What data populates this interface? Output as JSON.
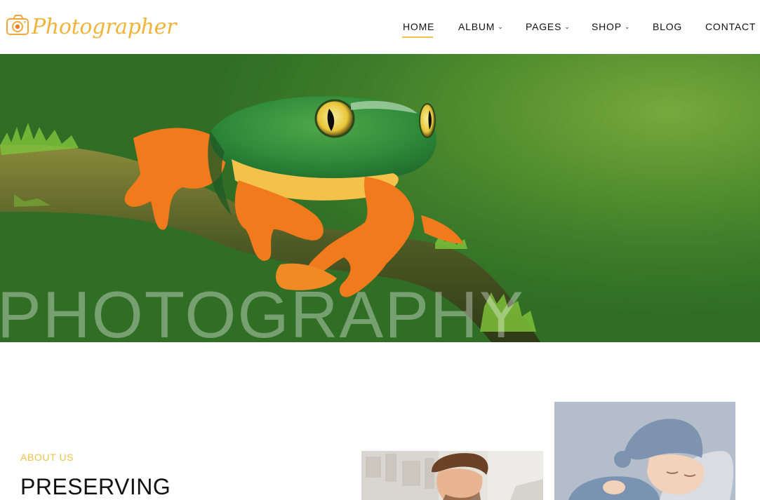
{
  "header": {
    "logo_text": "Photographer",
    "logo_icon": "camera-icon",
    "accent_color": "#f0b43c"
  },
  "nav": {
    "items": [
      {
        "label": "HOME",
        "active": true,
        "has_dropdown": false
      },
      {
        "label": "ALBUM",
        "active": false,
        "has_dropdown": true
      },
      {
        "label": "PAGES",
        "active": false,
        "has_dropdown": true
      },
      {
        "label": "SHOP",
        "active": false,
        "has_dropdown": true
      },
      {
        "label": "BLOG",
        "active": false,
        "has_dropdown": false
      },
      {
        "label": "CONTACT",
        "active": false,
        "has_dropdown": false
      }
    ],
    "dropdown_icon": "chevron-down-icon"
  },
  "hero": {
    "overlay_text": "PHOTOGRAPHY",
    "image_subject": "frog"
  },
  "about": {
    "label": "ABOUT US",
    "heading": "PRESERVING",
    "label_color": "#f0c24a"
  }
}
